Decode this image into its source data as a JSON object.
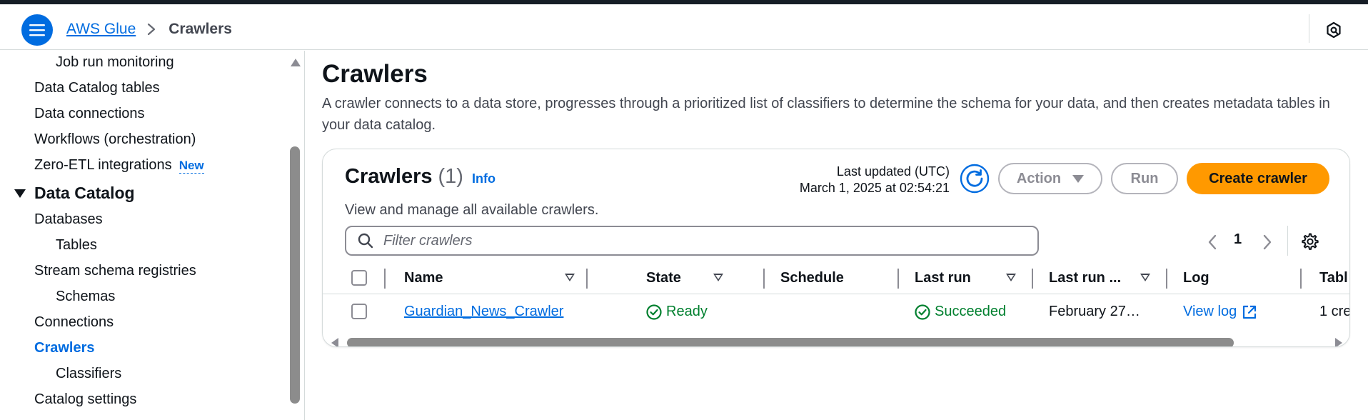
{
  "colors": {
    "accent": "#006ce0",
    "primary_button": "#ff9900",
    "success": "#00802f",
    "top_bar": "#161d26"
  },
  "header": {
    "menu_icon": "hamburger-menu-icon",
    "breadcrumb": {
      "service": "AWS Glue",
      "current": "Crawlers"
    },
    "right_icon": "notifications-icon"
  },
  "sidebar": {
    "items": [
      {
        "label": "Job run monitoring",
        "level": 2
      },
      {
        "label": "Data Catalog tables",
        "level": 1
      },
      {
        "label": "Data connections",
        "level": 1
      },
      {
        "label": "Workflows (orchestration)",
        "level": 1
      },
      {
        "label": "Zero-ETL integrations",
        "level": 1,
        "badge": "New"
      }
    ],
    "section": {
      "label": "Data Catalog",
      "expanded": true
    },
    "section_items": [
      {
        "label": "Databases",
        "level": 1
      },
      {
        "label": "Tables",
        "level": 2
      },
      {
        "label": "Stream schema registries",
        "level": 1
      },
      {
        "label": "Schemas",
        "level": 2
      },
      {
        "label": "Connections",
        "level": 1
      },
      {
        "label": "Crawlers",
        "level": 1,
        "active": true
      },
      {
        "label": "Classifiers",
        "level": 2
      },
      {
        "label": "Catalog settings",
        "level": 1
      }
    ]
  },
  "main": {
    "title": "Crawlers",
    "description": "A crawler connects to a data store, progresses through a prioritized list of classifiers to determine the schema for your data, and then creates metadata tables in your data catalog."
  },
  "crawlers_panel": {
    "title": "Crawlers",
    "count": "(1)",
    "info_link": "Info",
    "description": "View and manage all available crawlers.",
    "last_updated_label": "Last updated (UTC)",
    "last_updated_value": "March 1, 2025 at 02:54:21",
    "action_label": "Action",
    "run_label": "Run",
    "create_label": "Create crawler",
    "filter_placeholder": "Filter crawlers",
    "page": "1",
    "columns": [
      "Name",
      "State",
      "Schedule",
      "Last run",
      "Last run ...",
      "Log",
      "Tabl"
    ],
    "rows": [
      {
        "name": "Guardian_News_Crawler",
        "state": "Ready",
        "schedule": "",
        "last_run": "Succeeded",
        "last_run_timestamp": "February 27…",
        "log": "View log",
        "table_changes": "1 cre"
      }
    ]
  }
}
